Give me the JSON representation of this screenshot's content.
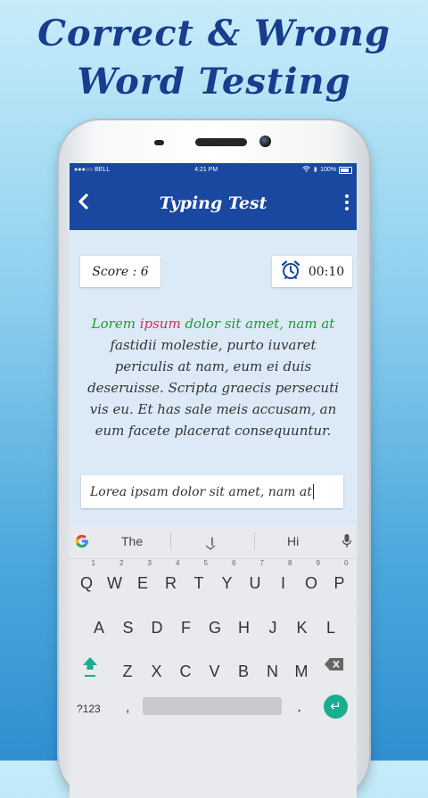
{
  "headline": {
    "line1": "Correct & Wrong",
    "line2": "Word Testing"
  },
  "status_bar": {
    "carrier": "●●●○○ BELL",
    "time": "4:21 PM",
    "battery": "100%",
    "wifi_icon": "wifi-icon",
    "bluetooth_icon": "bluetooth-icon"
  },
  "app_bar": {
    "back_icon": "back-chevron-icon",
    "title": "Typing Test",
    "menu_icon": "more-vert-icon"
  },
  "score": {
    "label": "Score :",
    "value": "6"
  },
  "timer": {
    "icon": "alarm-clock-icon",
    "value": "00:10"
  },
  "passage": {
    "segments": [
      {
        "text": "Lorem ",
        "status": "correct"
      },
      {
        "text": "ipsum",
        "status": "wrong"
      },
      {
        "text": " dolor sit amet, nam at",
        "status": "correct"
      },
      {
        "text": " fastidii molestie, purto iuvaret periculis at nam, eum ei duis deseruisse. Scripta graecis persecuti vis eu. Et has sale meis accusam, an eum facete placerat consequuntur.",
        "status": "pending"
      }
    ],
    "colors": {
      "correct": "#1e9b2f",
      "wrong": "#e02a4d",
      "pending": "#333333"
    }
  },
  "input": {
    "value": "Lorea ipsam dolor sit amet, nam at"
  },
  "keyboard": {
    "suggestions": [
      "The",
      "I",
      "Hi"
    ],
    "row1": [
      {
        "k": "Q",
        "n": "1"
      },
      {
        "k": "W",
        "n": "2"
      },
      {
        "k": "E",
        "n": "3"
      },
      {
        "k": "R",
        "n": "4"
      },
      {
        "k": "T",
        "n": "5"
      },
      {
        "k": "Y",
        "n": "6"
      },
      {
        "k": "U",
        "n": "7"
      },
      {
        "k": "I",
        "n": "8"
      },
      {
        "k": "O",
        "n": "9"
      },
      {
        "k": "P",
        "n": "0"
      }
    ],
    "row2": [
      "A",
      "S",
      "D",
      "F",
      "G",
      "H",
      "J",
      "K",
      "L"
    ],
    "row3": [
      "Z",
      "X",
      "C",
      "V",
      "B",
      "N",
      "M"
    ],
    "symbols_label": "?123",
    "comma": ",",
    "period": ".",
    "enter_symbol": "↵",
    "colors": {
      "enter": "#1bad8f",
      "shift": "#1bad8f"
    }
  }
}
